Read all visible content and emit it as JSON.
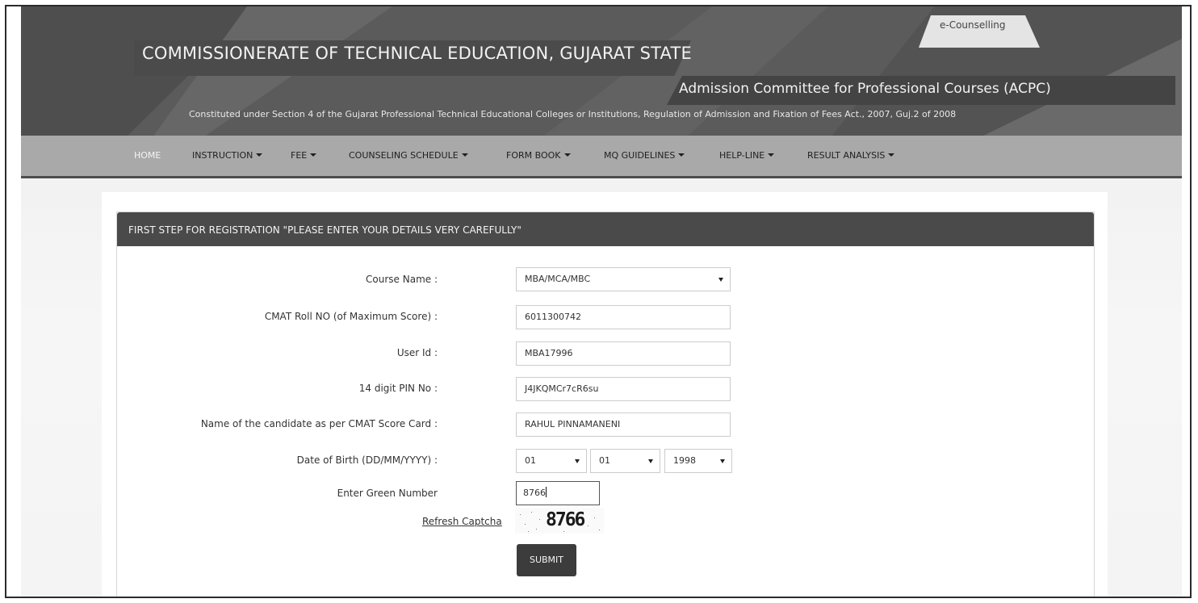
{
  "header": {
    "title": "COMMISSIONERATE OF TECHNICAL EDUCATION, GUJARAT STATE",
    "committee": "Admission Committee for Professional Courses (ACPC)",
    "subtitle": "Constituted under Section 4 of the Gujarat Professional Technical Educational Colleges or Institutions, Regulation of Admission and Fixation of Fees Act., 2007, Guj.2 of 2008",
    "tag": "e-Counselling"
  },
  "nav": {
    "items": [
      {
        "label": "HOME",
        "dropdown": false,
        "active": true
      },
      {
        "label": "INSTRUCTION",
        "dropdown": true
      },
      {
        "label": "FEE",
        "dropdown": true
      },
      {
        "label": "COUNSELING SCHEDULE",
        "dropdown": true
      },
      {
        "label": "FORM BOOK",
        "dropdown": true
      },
      {
        "label": "MQ GUIDELINES",
        "dropdown": true
      },
      {
        "label": "HELP-LINE",
        "dropdown": true
      },
      {
        "label": "RESULT ANALYSIS",
        "dropdown": true
      }
    ]
  },
  "form": {
    "heading": "FIRST STEP FOR REGISTRATION \"PLEASE ENTER YOUR DETAILS VERY CAREFULLY\"",
    "course": {
      "label": "Course Name :",
      "value": "MBA/MCA/MBC"
    },
    "cmat_roll": {
      "label": "CMAT Roll NO (of Maximum Score) :",
      "value": "6011300742"
    },
    "user_id": {
      "label": "User Id :",
      "value": "MBA17996"
    },
    "pin": {
      "label": "14 digit PIN No :",
      "value": "J4JKQMCr7cR6su"
    },
    "name": {
      "label": "Name of the candidate as per CMAT Score Card :",
      "value": "RAHUL PINNAMANENI"
    },
    "dob": {
      "label": "Date of Birth (DD/MM/YYYY) :",
      "day": "01",
      "month": "01",
      "year": "1998"
    },
    "green": {
      "label": "Enter Green Number",
      "value": "8766"
    },
    "refresh_label": "Refresh Captcha",
    "captcha": "8766",
    "submit_label": "SUBMIT"
  }
}
